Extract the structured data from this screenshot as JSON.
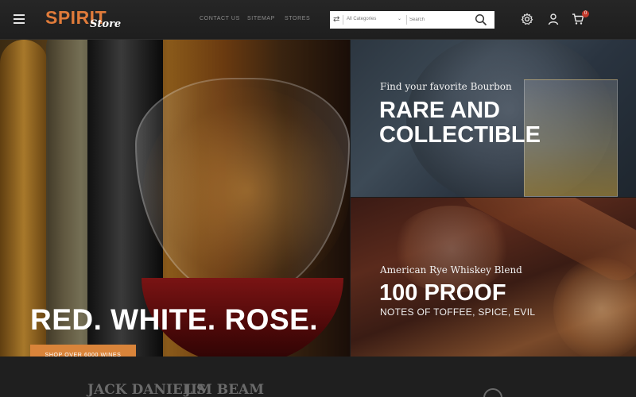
{
  "header": {
    "logo_main": "SPIRIT",
    "logo_sub": "Store",
    "nav": [
      "CONTACT US",
      "SITEMAP",
      "STORES"
    ],
    "search": {
      "category": "All Categories",
      "placeholder": "Search"
    },
    "cart_count": "0"
  },
  "hero": {
    "left": {
      "title": "RED. WHITE. ROSE.",
      "button": "SHOP OVER 6000 WINES"
    },
    "right_top": {
      "subtitle": "Find your favorite Bourbon",
      "title": "RARE AND COLLECTIBLE"
    },
    "right_bottom": {
      "subtitle": "American Rye Whiskey Blend",
      "title": "100 PROOF",
      "description": "NOTES OF TOFFEE, SPICE, EVIL"
    }
  },
  "brands": [
    "JACK DANIEL'S",
    "JIM BEAM"
  ],
  "colors": {
    "accent": "#d9843a",
    "header_bg": "#222222",
    "badge": "#c0392b"
  },
  "icons": [
    "menu-icon",
    "swap-icon",
    "search-icon",
    "gear-icon",
    "user-icon",
    "cart-icon"
  ]
}
